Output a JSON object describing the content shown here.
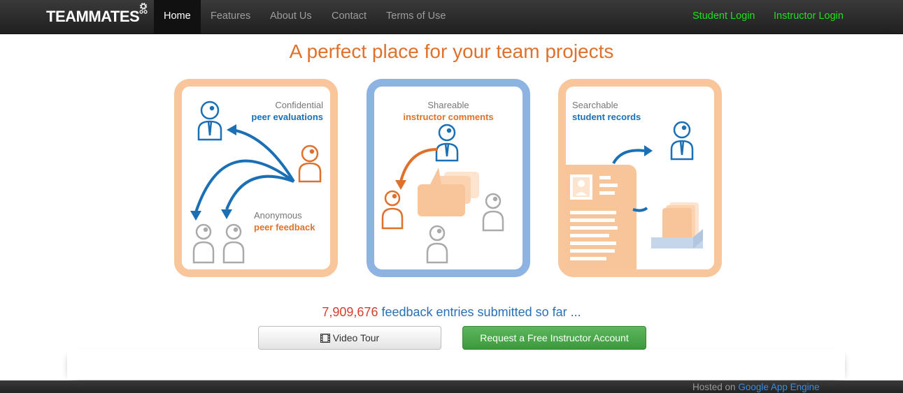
{
  "nav": {
    "brand": "TEAMMATES",
    "items": [
      {
        "label": "Home",
        "active": true
      },
      {
        "label": "Features"
      },
      {
        "label": "About Us"
      },
      {
        "label": "Contact"
      },
      {
        "label": "Terms of Use"
      }
    ],
    "student_login": "Student Login",
    "instructor_login": "Instructor Login"
  },
  "headline": "A perfect place for your team projects",
  "panels": [
    {
      "border_color": "#f9c59a",
      "line1": "Confidential",
      "line2": "peer evaluations",
      "line3": "Anonymous",
      "line4": "peer feedback"
    },
    {
      "border_color": "#8db3e2",
      "line1": "Shareable",
      "line2": "instructor comments"
    },
    {
      "border_color": "#f9c59a",
      "line1": "Searchable",
      "line2": "student records"
    }
  ],
  "counter": {
    "number": "7,909,676",
    "text": "feedback entries submitted so far ..."
  },
  "buttons": {
    "video_tour": "Video Tour",
    "request_account": "Request a Free Instructor Account"
  },
  "footer": {
    "prefix": "Hosted on",
    "link": "Google App Engine"
  },
  "colors": {
    "accent_orange": "#e0712b",
    "accent_blue": "#1a6fb5",
    "login_green": "#22dd22",
    "button_green": "#5cb85c"
  }
}
